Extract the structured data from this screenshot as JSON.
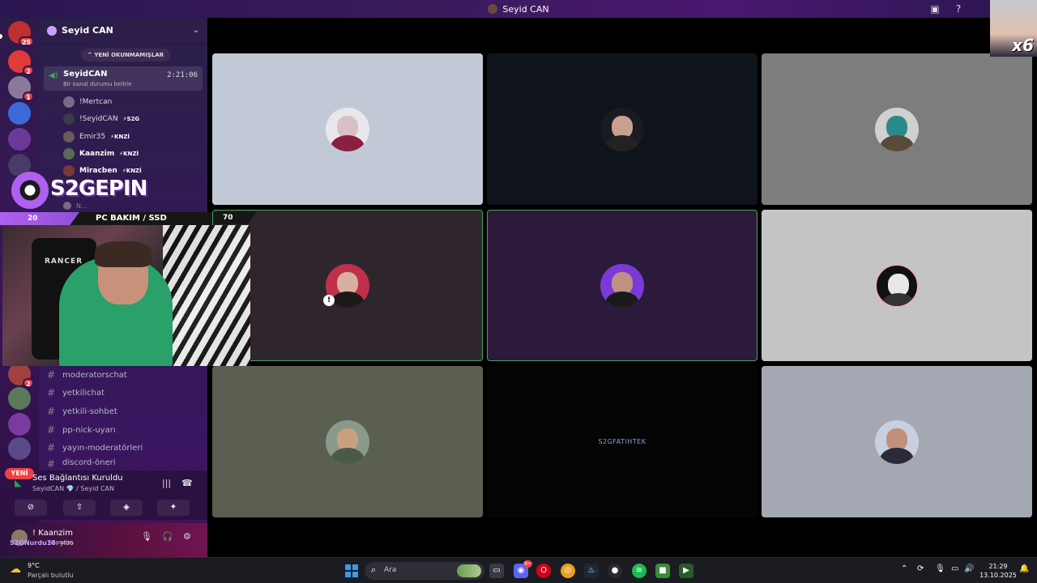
{
  "window": {
    "title": "Seyid CAN"
  },
  "rail": {
    "badges": [
      "25",
      "2",
      "1",
      "2"
    ],
    "new_label": "YENİ"
  },
  "guild": {
    "name": "Seyid CAN",
    "unread_label": "YENİ OKUNMAMIŞLAR"
  },
  "voice_channel": {
    "name": "SeyidCAN",
    "status_prompt": "Bir kanal durumu belirle",
    "elapsed": "2:21:06",
    "members": [
      {
        "name": "!Mertcan",
        "tag": ""
      },
      {
        "name": "!SeyidCAN",
        "tag": "S2G"
      },
      {
        "name": "Emir35",
        "tag": "KNZİ"
      },
      {
        "name": "Kaanzim",
        "tag": "KNZİ"
      },
      {
        "name": "Miracben",
        "tag": "KNZİ"
      },
      {
        "name": "N...",
        "tag": ""
      }
    ]
  },
  "channels": [
    {
      "name": "moderatorschat"
    },
    {
      "name": "yetkilichat"
    },
    {
      "name": "yetkili-sohbet"
    },
    {
      "name": "pp-nick-uyarı"
    },
    {
      "name": "yayın-moderatörleri"
    },
    {
      "name": "discord-öneri"
    }
  ],
  "voice_connection": {
    "status": "Ses Bağlantısı Kuruldu",
    "location": "SeyidCAN 💎 / Seyid CAN"
  },
  "user": {
    "name": "! Kaanzim",
    "chat_user": "S2GNurdu16",
    "chat_text": "yloo",
    "status": "Kaanzim"
  },
  "stream_overlay": {
    "logo_text": "S2GEPIN",
    "bar_number": "20",
    "bar_text": "PC BAKIM / SSD",
    "tile_number": "70",
    "chair_brand": "RANCER",
    "corner_label": "x6"
  },
  "video_grid": {
    "tiles": [
      {
        "bg": "#c2c9d6",
        "name": "",
        "speaking": false
      },
      {
        "bg": "#0f131a",
        "name": "",
        "speaking": false
      },
      {
        "bg": "#7d7d7d",
        "name": "",
        "speaking": false
      },
      {
        "bg": "#2f262d",
        "name": "",
        "speaking": true
      },
      {
        "bg": "#2c1a3c",
        "name": "",
        "speaking": true
      },
      {
        "bg": "#c4c4c4",
        "name": "",
        "speaking": false
      },
      {
        "bg": "#5a5f52",
        "name": "",
        "speaking": false
      },
      {
        "bg": "#050505",
        "name": "S2GFATIHTEK",
        "speaking": false
      },
      {
        "bg": "#a3a8b3",
        "name": "",
        "speaking": false
      }
    ]
  },
  "taskbar": {
    "temperature": "9°C",
    "condition": "Parçalı bulutlu",
    "search_placeholder": "Ara",
    "discord_badge": "9+",
    "time": "21:29",
    "date": "13.10.2025"
  },
  "colors": {
    "speaking_outline": "#3ba55c",
    "accent": "#b060f0",
    "badge": "#f23f43"
  }
}
